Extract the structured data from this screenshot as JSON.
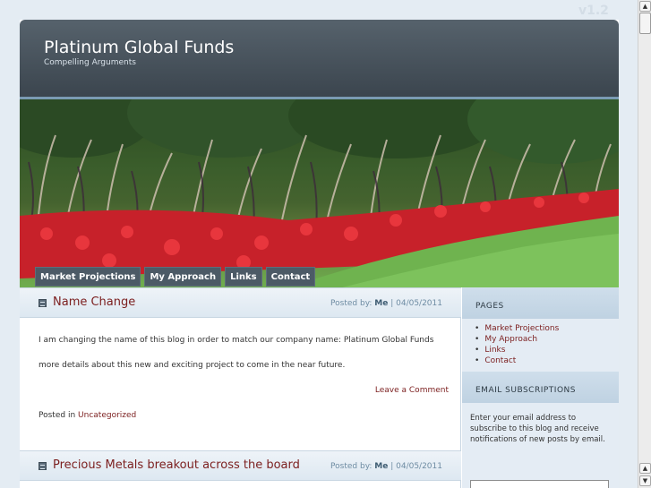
{
  "version": "v1.2",
  "header": {
    "title": "Platinum Global Funds",
    "tagline": "Compelling Arguments"
  },
  "nav": [
    "Market Projections",
    "My Approach",
    "Links",
    "Contact"
  ],
  "posts": [
    {
      "title": "Name Change",
      "posted_by_label": "Posted by:",
      "author": "Me",
      "date": "| 04/05/2011",
      "paragraphs": [
        "I am changing the name of this blog in order to match our company name: Platinum Global Funds",
        "more details about this new and exciting project to come in the near future."
      ],
      "comment_link": "Leave a Comment",
      "posted_in_label": "Posted in",
      "category": "Uncategorized"
    },
    {
      "title": "Precious Metals breakout across the board",
      "posted_by_label": "Posted by:",
      "author": "Me",
      "date": "| 04/05/2011"
    }
  ],
  "sidebar": {
    "pages_heading": "PAGES",
    "pages": [
      "Market Projections",
      "My Approach",
      "Links",
      "Contact"
    ],
    "email_heading": "EMAIL SUBSCRIPTIONS",
    "email_text": "Enter your email address to subscribe to this blog and receive notifications of new posts by email.",
    "email_placeholder": ""
  },
  "colors": {
    "link": "#7b1e1e",
    "header_bg": "#3b454e",
    "nav_bg": "#4c5a66"
  }
}
